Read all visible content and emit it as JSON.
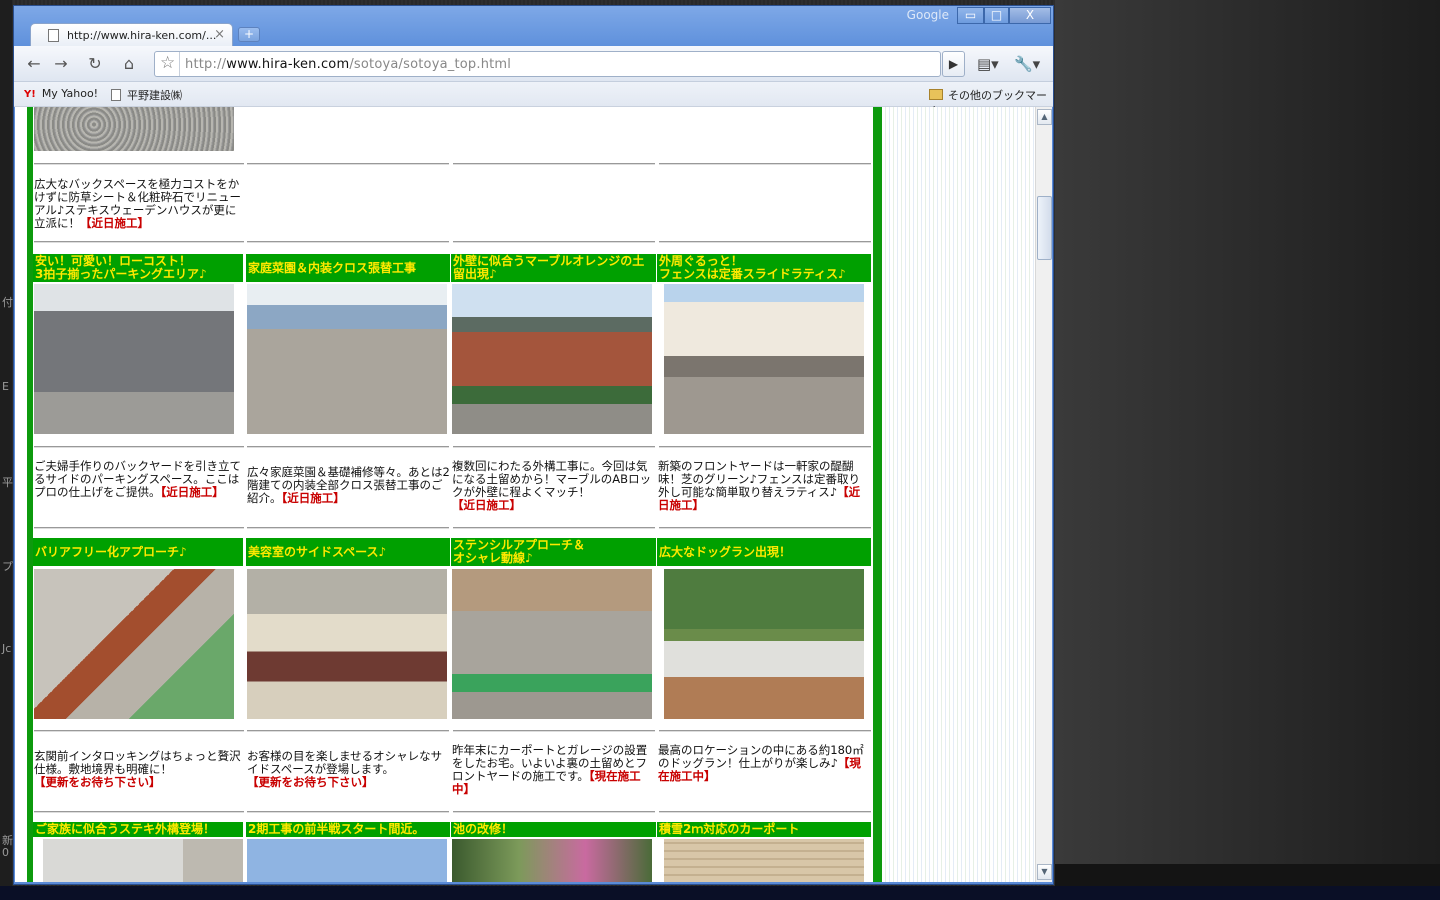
{
  "desktop": {
    "left_glyphs": [
      "付",
      "E",
      "平",
      "プ",
      "Jc",
      "新",
      "0"
    ]
  },
  "window": {
    "title_brand": "Google",
    "controls": {
      "minimize": "▭",
      "maximize": "□",
      "close": "X"
    },
    "tab": {
      "title": "http://www.hira-ken.com/...",
      "close": "×"
    },
    "newtab": "+"
  },
  "toolbar": {
    "back": "←",
    "forward": "→",
    "reload": "↻",
    "home": "⌂",
    "url_prefix": "http://",
    "url_host": "www.hira-ken.com",
    "url_path": "/sotoya/sotoya_top.html",
    "go": "▶",
    "page_menu": "▤▾",
    "wrench_menu": "🔧▾"
  },
  "bookmarks": [
    {
      "label": "My Yahoo!",
      "icon": "Y!"
    },
    {
      "label": "平野建設㈱",
      "icon": "page-icon"
    }
  ],
  "other_bookmarks": "その他のブックマーク",
  "scrollbar": {
    "up": "▲",
    "down": "▼",
    "position": 0.14
  },
  "page": {
    "top_desc": {
      "text": "広大なバックスペースを極力コストをかけずに防草シート＆化粧砕石でリニューアル♪ステキスウェーデンハウスが更に立派に！",
      "red": "【近日施工】"
    },
    "row1": [
      {
        "title": "安い！可愛い！ローコスト！\n3拍子揃ったパーキングエリア♪",
        "text": "ご夫婦手作りのバックヤードを引き立てるサイドのパーキングスペース。ここはプロの仕上げをご提供。",
        "red": "【近日施工】"
      },
      {
        "title": "家庭菜園＆内装クロス張替工事",
        "text": "広々家庭菜園＆基礎補修等々。あとは2階建ての内装全部クロス張替工事のご紹介。",
        "red": "【近日施工】"
      },
      {
        "title": "外壁に似合うマーブルオレンジの土留出現♪",
        "text": "複数回にわたる外構工事に。今回は気になる土留めから！マーブルのABロックが外壁に程よくマッチ！",
        "red": "【近日施工】"
      },
      {
        "title": "外周ぐるっと！\nフェンスは定番スライドラティス♪",
        "text": "新築のフロントヤードは一軒家の醍醐味！芝のグリーン♪フェンスは定番取り外し可能な簡単取り替えラティス♪",
        "red": "【近日施工】"
      }
    ],
    "row2": [
      {
        "title": "バリアフリー化アプローチ♪",
        "text": "玄関前インタロッキングはちょっと贅沢仕様。敷地境界も明確に！",
        "red": "【更新をお待ち下さい】"
      },
      {
        "title": "美容室のサイドスペース♪",
        "text": "お客様の目を楽しませるオシャレなサイドスペースが登場します。",
        "red": "【更新をお待ち下さい】"
      },
      {
        "title": "ステンシルアプローチ＆\nオシャレ動線♪",
        "text": "昨年末にカーポートとガレージの設置をしたお宅。いよいよ裏の土留めとフロントヤードの施工です。",
        "red": "【現在施工中】"
      },
      {
        "title": "広大なドッグラン出現！",
        "text": "最高のロケーションの中にある約180㎡のドッグラン！仕上がりが楽しみ♪",
        "red": "【現在施工中】"
      }
    ],
    "row3": [
      {
        "title": "ご家族に似合うステキ外構登場！"
      },
      {
        "title": "2期工事の前半戦スタート間近。"
      },
      {
        "title": "池の改修！"
      },
      {
        "title": "積雪2ｍ対応のカーポート"
      }
    ]
  },
  "colors": {
    "header_bg": "#00a000",
    "header_text": "#ffe900",
    "accent_red": "#c80000",
    "chrome_blue": "#5f91dc"
  }
}
